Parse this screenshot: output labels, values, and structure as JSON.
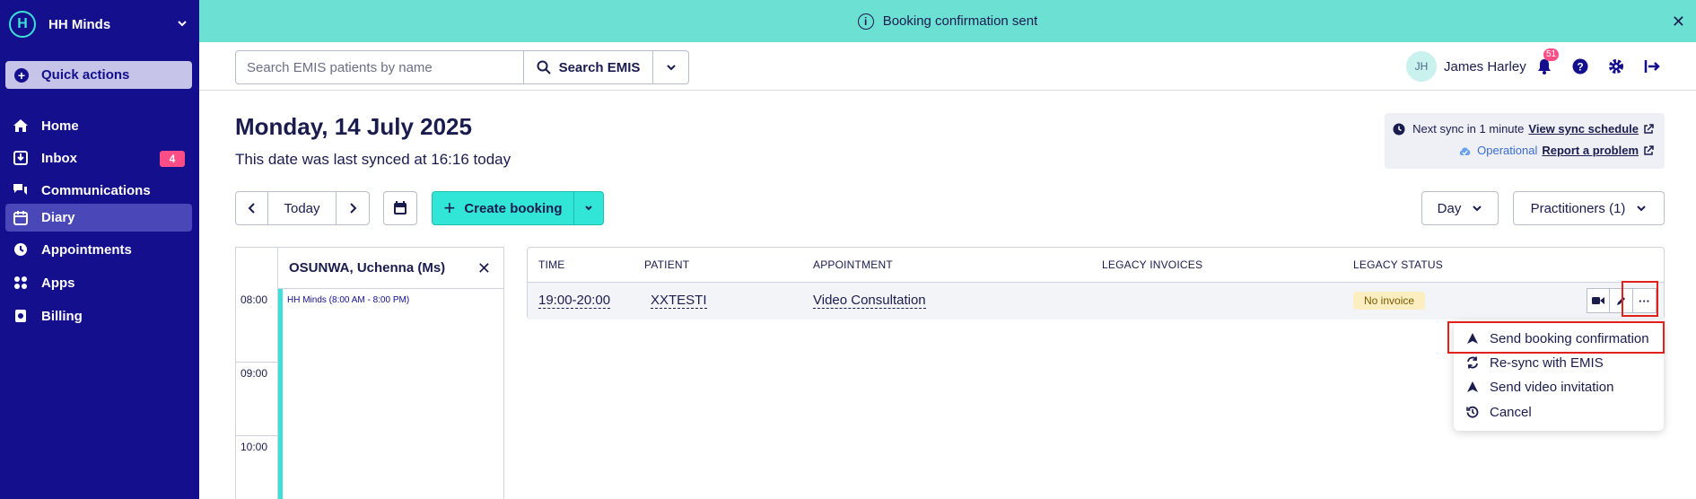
{
  "sidebar": {
    "brand": "HH Minds",
    "quick_actions": "Quick actions",
    "items": [
      {
        "label": "Home"
      },
      {
        "label": "Inbox",
        "badge": "4"
      },
      {
        "label": "Communications"
      },
      {
        "label": "Diary",
        "active": true
      },
      {
        "label": "Appointments"
      },
      {
        "label": "Apps"
      },
      {
        "label": "Billing"
      }
    ]
  },
  "toast": {
    "message": "Booking confirmation sent",
    "close": "✕"
  },
  "header": {
    "search_placeholder": "Search EMIS patients by name",
    "search_button": "Search EMIS",
    "user_initials": "JH",
    "user_name": "James Harley",
    "notifications_count": "51"
  },
  "page": {
    "date_title": "Monday, 14 July 2025",
    "sync_note": "This date was last synced at 16:16 today",
    "next_sync": "Next sync in 1 minute",
    "view_sync_schedule": "View sync schedule",
    "status": "Operational",
    "report_problem": "Report a problem"
  },
  "toolbar": {
    "today": "Today",
    "create_booking": "Create booking",
    "view_mode": "Day",
    "practitioners": "Practitioners (1)"
  },
  "calendar": {
    "practitioner": "OSUNWA, Uchenna (Ms)",
    "availability": "HH Minds (8:00 AM - 8:00 PM)",
    "times": [
      "08:00",
      "09:00",
      "10:00"
    ]
  },
  "table": {
    "headers": [
      "TIME",
      "PATIENT",
      "APPOINTMENT",
      "LEGACY INVOICES",
      "LEGACY STATUS"
    ],
    "row": {
      "time": "19:00-20:00",
      "patient": "XXTESTI",
      "appointment": "Video Consultation",
      "status": "No invoice",
      "more": "···"
    }
  },
  "menu": {
    "items": [
      {
        "label": "Send booking confirmation",
        "icon": "send-icon"
      },
      {
        "label": "Re-sync with EMIS",
        "icon": "sync-icon"
      },
      {
        "label": "Send video invitation",
        "icon": "send-icon"
      },
      {
        "label": "Cancel",
        "icon": "history-icon"
      }
    ]
  },
  "colors": {
    "sidebar": "#140f8c",
    "accent": "#31e6d6",
    "toast": "#6de0d4",
    "highlight": "#e2201c"
  }
}
